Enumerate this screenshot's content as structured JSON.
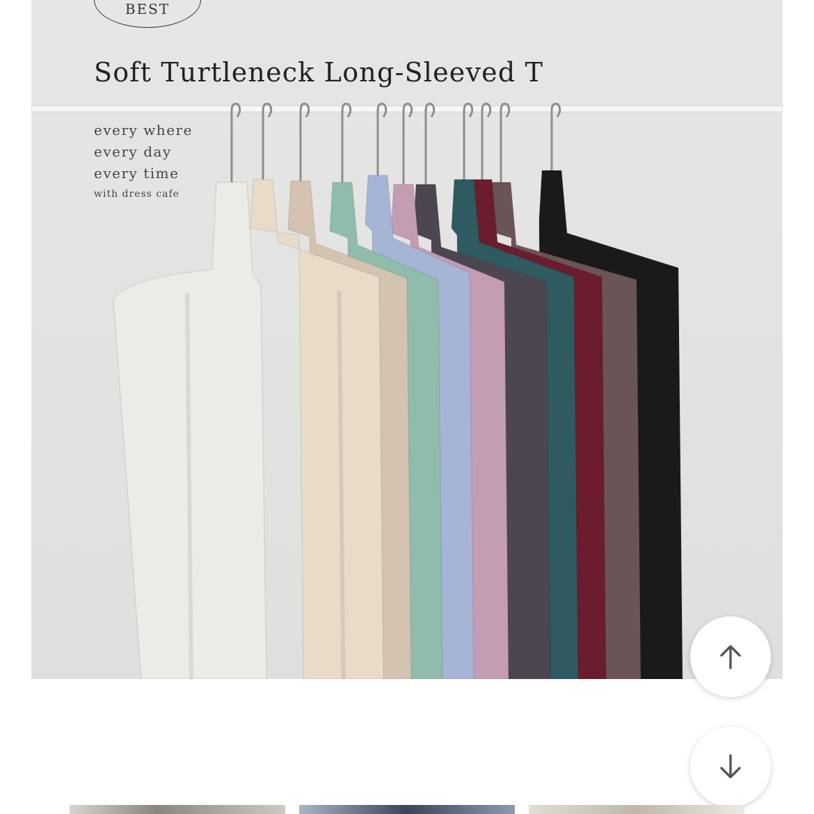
{
  "product": {
    "badge": "BEST",
    "title": "Soft Turtleneck Long-Sleeved T",
    "tagline": {
      "line1": "every where",
      "line2": "every day",
      "line3": "every time",
      "line4": "with dress cafe"
    }
  },
  "colors": {
    "shirts": [
      "#ecebe5",
      "#e8dcc9",
      "#d3c3b0",
      "#8fbcab",
      "#a6b4d6",
      "#c49cb4",
      "#4c4651",
      "#2e5a60",
      "#6b1c2e",
      "#6b5455",
      "#1a1a1a"
    ]
  },
  "icons": {
    "scroll_up": "arrow-up-icon",
    "scroll_down": "arrow-down-icon"
  }
}
